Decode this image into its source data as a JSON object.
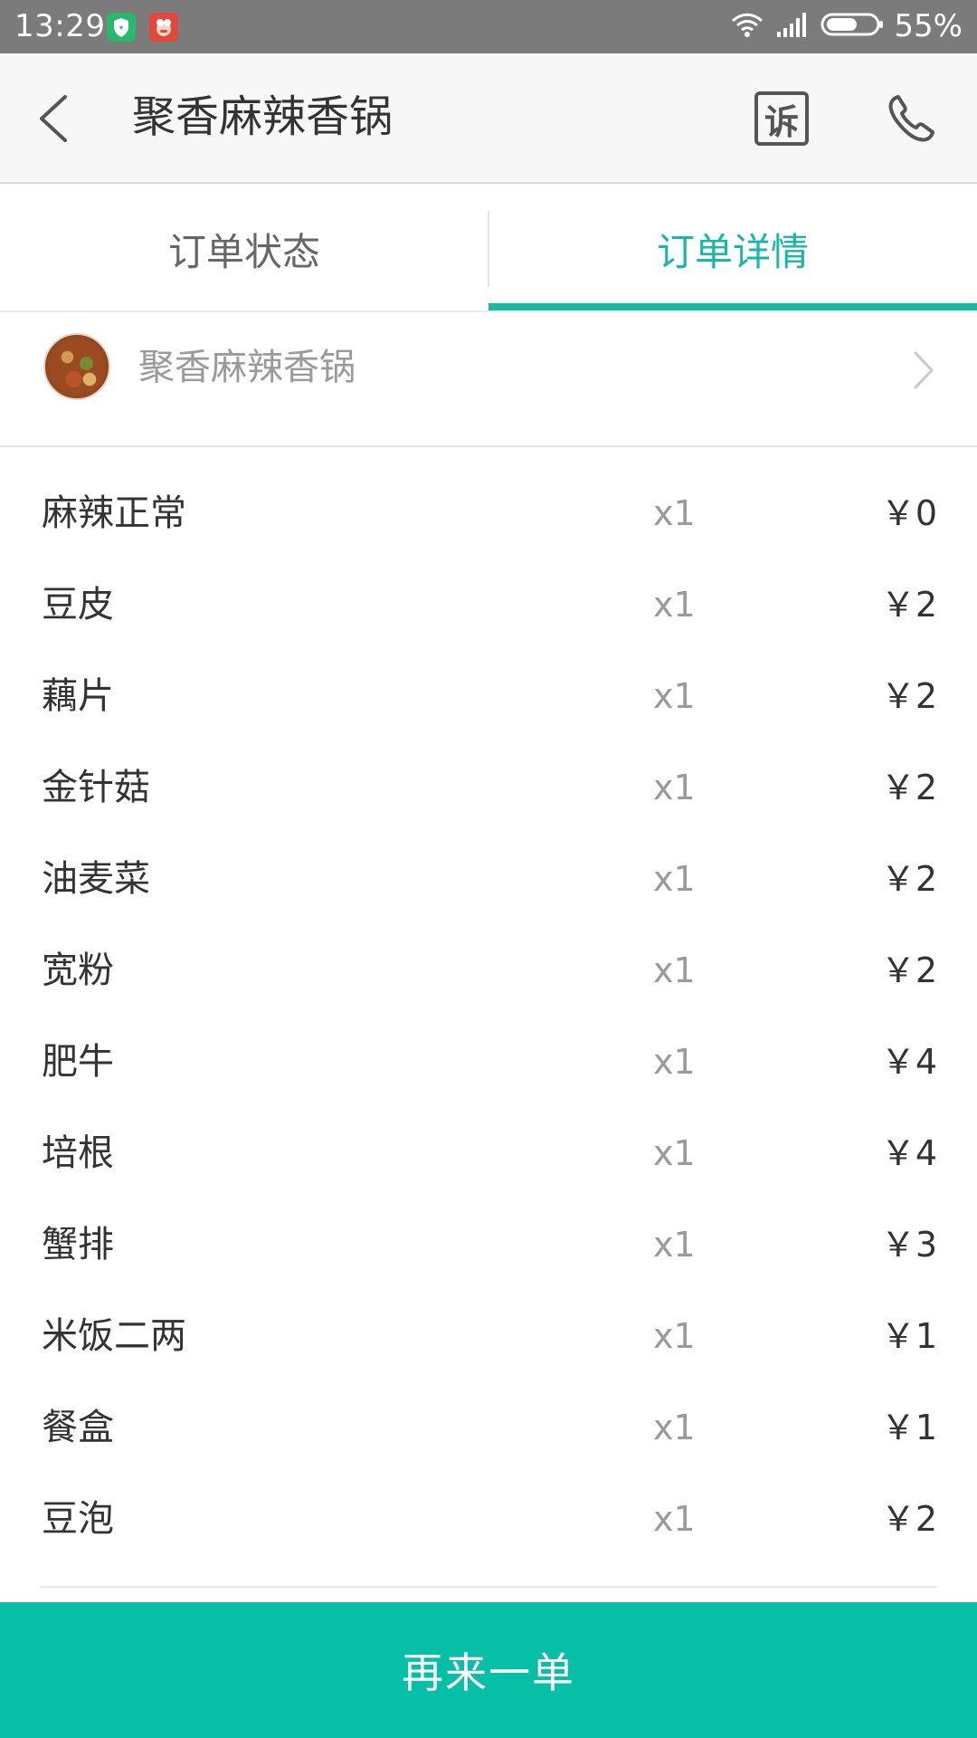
{
  "status_bar": {
    "time": "13:29",
    "battery_percent": "55%"
  },
  "header": {
    "title": "聚香麻辣香锅",
    "complain_label": "诉"
  },
  "tabs": [
    {
      "label": "订单状态",
      "selected": false
    },
    {
      "label": "订单详情",
      "selected": true
    }
  ],
  "restaurant": {
    "name": "聚香麻辣香锅"
  },
  "items": [
    {
      "name": "麻辣正常",
      "qty": "x1",
      "price": "￥0"
    },
    {
      "name": "豆皮",
      "qty": "x1",
      "price": "￥2"
    },
    {
      "name": "藕片",
      "qty": "x1",
      "price": "￥2"
    },
    {
      "name": "金针菇",
      "qty": "x1",
      "price": "￥2"
    },
    {
      "name": "油麦菜",
      "qty": "x1",
      "price": "￥2"
    },
    {
      "name": "宽粉",
      "qty": "x1",
      "price": "￥2"
    },
    {
      "name": "肥牛",
      "qty": "x1",
      "price": "￥4"
    },
    {
      "name": "培根",
      "qty": "x1",
      "price": "￥4"
    },
    {
      "name": "蟹排",
      "qty": "x1",
      "price": "￥3"
    },
    {
      "name": "米饭二两",
      "qty": "x1",
      "price": "￥1"
    },
    {
      "name": "餐盒",
      "qty": "x1",
      "price": "￥1"
    },
    {
      "name": "豆泡",
      "qty": "x1",
      "price": "￥2"
    }
  ],
  "footer": {
    "reorder_label": "再来一单"
  },
  "colors": {
    "accent": "#19b7a4",
    "button": "#07bfa7",
    "status_bar": "#7b7b7b"
  }
}
